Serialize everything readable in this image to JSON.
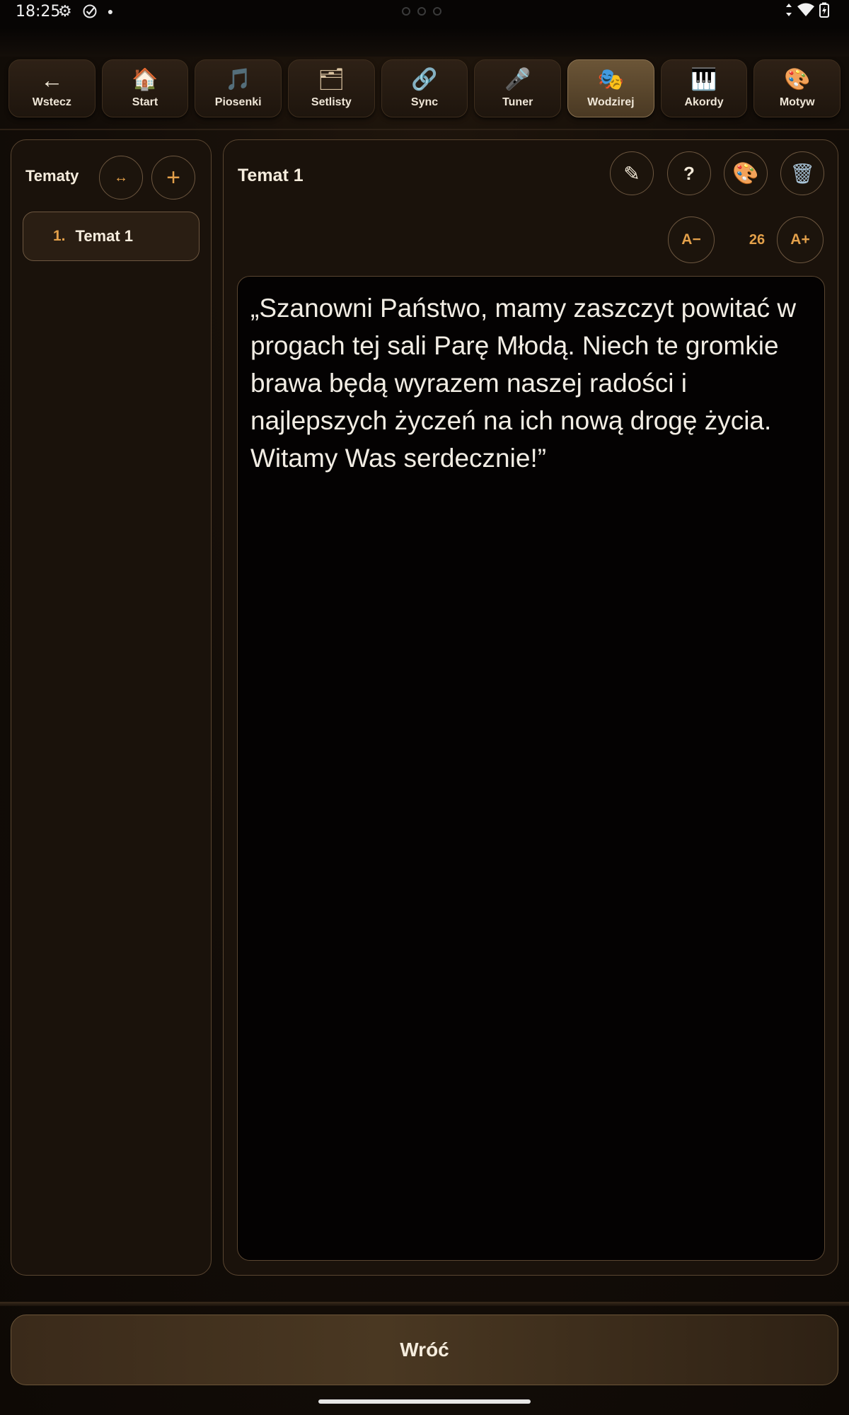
{
  "status": {
    "time": "18:25"
  },
  "nav": {
    "items": [
      {
        "label": "Wstecz",
        "icon": "←",
        "icon_name": "arrow-left-icon",
        "active": false
      },
      {
        "label": "Start",
        "icon": "🏠",
        "icon_name": "home-icon",
        "active": false
      },
      {
        "label": "Piosenki",
        "icon": "🎵",
        "icon_name": "music-note-icon",
        "active": false
      },
      {
        "label": "Setlisty",
        "icon": "🗂",
        "icon_name": "folder-icon",
        "active": false
      },
      {
        "label": "Sync",
        "icon": "🔗",
        "icon_name": "link-icon",
        "active": false
      },
      {
        "label": "Tuner",
        "icon": "🎤",
        "icon_name": "microphone-icon",
        "active": false
      },
      {
        "label": "Wodzirej",
        "icon": "🎭",
        "icon_name": "theater-masks-icon",
        "active": true
      },
      {
        "label": "Akordy",
        "icon": "🎹",
        "icon_name": "piano-icon",
        "active": false
      },
      {
        "label": "Motyw",
        "icon": "🎨",
        "icon_name": "palette-icon",
        "active": false
      }
    ]
  },
  "sidebar": {
    "title": "Tematy",
    "swap_icon": "↔",
    "add_icon": "+",
    "topics": [
      {
        "number": "1.",
        "name": "Temat 1"
      }
    ]
  },
  "main": {
    "title": "Temat 1",
    "actions": {
      "edit_icon": "✎",
      "help_label": "?",
      "palette_icon": "🎨",
      "delete_icon": "🗑"
    },
    "font": {
      "decrease_label": "A−",
      "size": "26",
      "increase_label": "A+"
    },
    "text": "„Szanowni Państwo, mamy zaszczyt powitać w progach tej sali Parę Młodą. Niech te gromkie brawa będą wyrazem naszej radości i najlepszych życzeń na ich nową drogę życia. Witamy Was serdecznie!”"
  },
  "footer": {
    "back_label": "Wróć"
  },
  "colors": {
    "accent": "#e3a04a",
    "active_tab": "#6b5537",
    "panel_border": "#5a4631"
  }
}
